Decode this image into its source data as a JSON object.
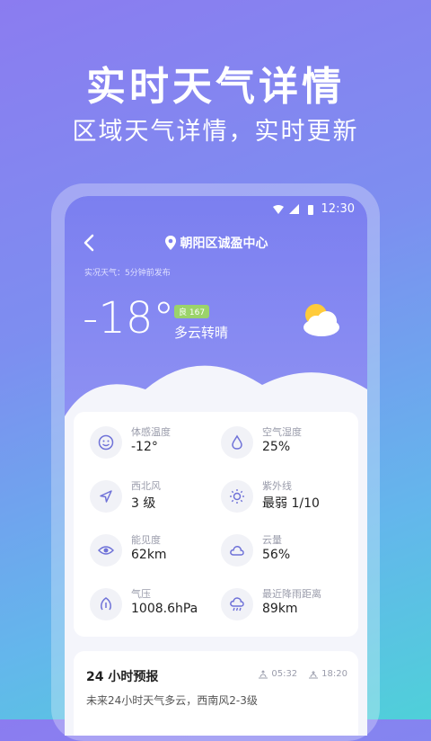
{
  "hero": {
    "title": "实时天气详情",
    "subtitle": "区域天气详情，实时更新"
  },
  "status": {
    "time": "12:30"
  },
  "header": {
    "location": "朝阳区诚盈中心"
  },
  "current": {
    "live_label": "实况天气：5分钟前发布",
    "temperature": "-18°",
    "aqi": "良 167",
    "condition": "多云转晴"
  },
  "details": [
    {
      "icon": "smile-icon",
      "label": "体感温度",
      "value": "-12°"
    },
    {
      "icon": "droplet-icon",
      "label": "空气湿度",
      "value": "25%"
    },
    {
      "icon": "navigation-icon",
      "label": "西北风",
      "value": "3 级"
    },
    {
      "icon": "sun-icon",
      "label": "紫外线",
      "value": "最弱 1/10"
    },
    {
      "icon": "eye-icon",
      "label": "能见度",
      "value": "62km"
    },
    {
      "icon": "cloud-icon",
      "label": "云量",
      "value": "56%"
    },
    {
      "icon": "pressure-icon",
      "label": "气压",
      "value": "1008.6hPa"
    },
    {
      "icon": "rain-cloud-icon",
      "label": "最近降雨距离",
      "value": "89km"
    }
  ],
  "forecast": {
    "title": "24 小时预报",
    "sunrise": "05:32",
    "sunset": "18:20",
    "description": "未来24小时天气多云，西南风2-3级"
  },
  "colors": {
    "accent": "#7b7ff0",
    "aqi_badge": "#9bd36a"
  }
}
